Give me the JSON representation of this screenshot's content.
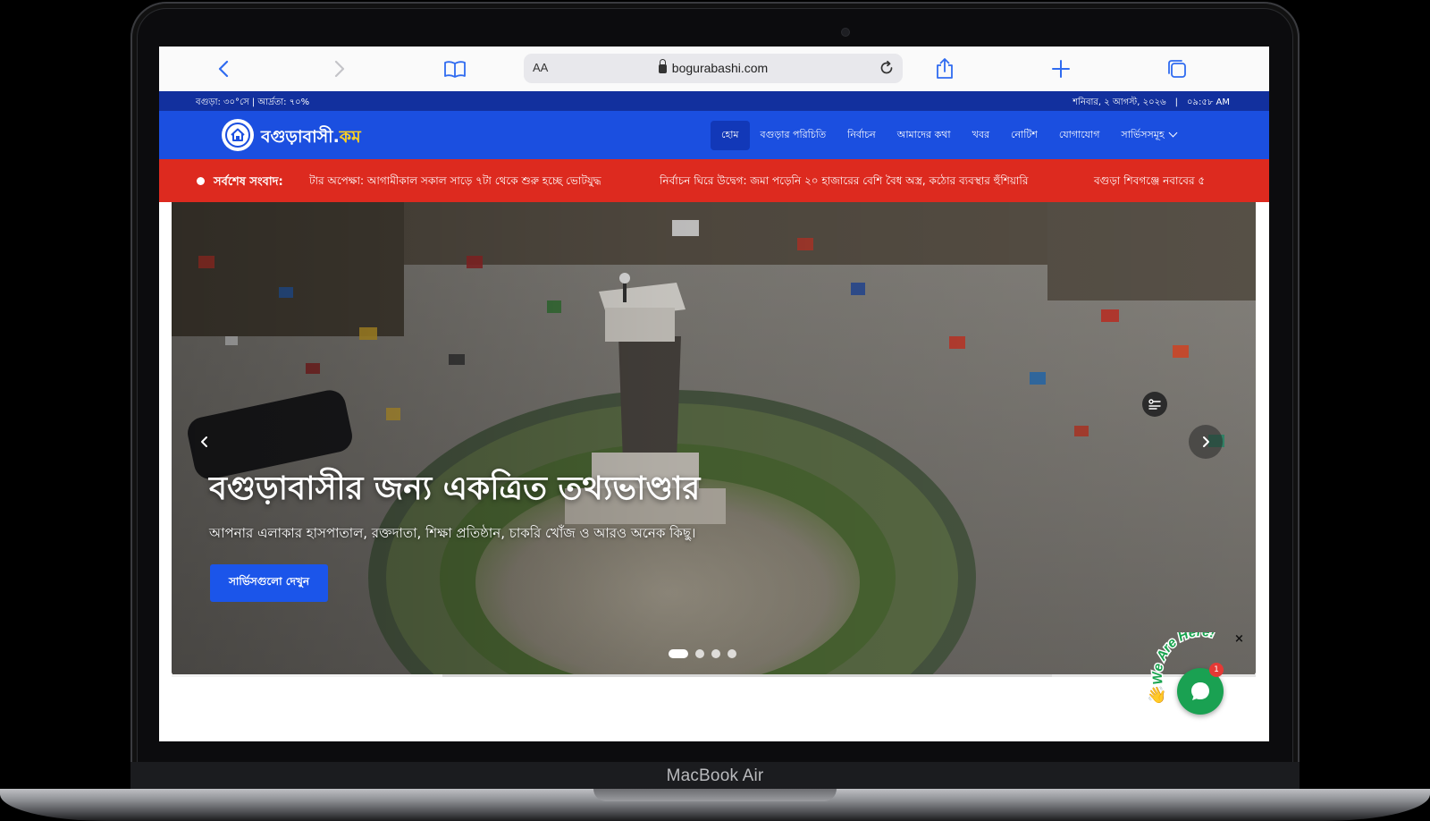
{
  "device": {
    "label": "MacBook Air"
  },
  "browser": {
    "text_size_label": "AA",
    "url": "bogurabashi.com"
  },
  "info_bar": {
    "weather": "বগুড়া: ৩০°সে | আর্দ্রতা: ৭০%",
    "date": "শনিবার, ২ আগস্ট, ২০২৬",
    "time": "০৯:৫৮ AM"
  },
  "site": {
    "name": "বগুড়াবাসী.",
    "name_accent": "কম"
  },
  "nav": {
    "items": [
      {
        "label": "হোম",
        "active": true
      },
      {
        "label": "বগুড়ার পরিচিতি"
      },
      {
        "label": "নির্বাচন"
      },
      {
        "label": "আমাদের কথা"
      },
      {
        "label": "খবর"
      },
      {
        "label": "নোটিশ"
      },
      {
        "label": "যোগাযোগ"
      },
      {
        "label": "সার্ভিসসমূহ"
      }
    ]
  },
  "ticker": {
    "label": "সর্বশেষ সংবাদ:",
    "items": [
      "টার অপেক্ষা: আগামীকাল সকাল সাড়ে ৭টা থেকে শুরু হচ্ছে ভোটযুদ্ধ",
      "নির্বাচন ঘিরে উদ্বেগ: জমা পড়েনি ২০ হাজারের বেশি বৈধ অস্ত্র, কঠোর ব্যবস্থার হুঁশিয়ারি",
      "বগুড়া শিবগঞ্জে নবাবের ৫"
    ]
  },
  "hero": {
    "title": "বগুড়াবাসীর জন্য একত্রিত তথ্যভাণ্ডার",
    "subtitle": "আপনার এলাকার হাসপাতাল, রক্তদাতা, শিক্ষা প্রতিষ্ঠান, চাকরি খোঁজ ও আরও অনেক কিছু।",
    "cta_label": "সার্ভিসগুলো দেখুন",
    "slide_count": 4,
    "active_slide": 1,
    "progress": 0.25
  },
  "chat": {
    "label": "We Are Here!",
    "badge_count": "1",
    "close_glyph": "×",
    "wave_glyph": "👋"
  },
  "colors": {
    "info_bar": "#12309e",
    "header": "#1b4fe0",
    "ticker": "#dd2a1f",
    "cta": "#1b55ea",
    "chat": "#1aa152",
    "logo_accent": "#ffd21f"
  },
  "icons": {
    "back": "chevron-left-icon",
    "forward": "chevron-right-icon",
    "bookmarks": "book-icon",
    "lock": "lock-icon",
    "reload": "reload-icon",
    "share": "share-icon",
    "new_tab": "plus-icon",
    "tabs": "tabs-icon",
    "logo": "home-icon",
    "filter": "filter-icon",
    "chat": "chat-icon"
  }
}
